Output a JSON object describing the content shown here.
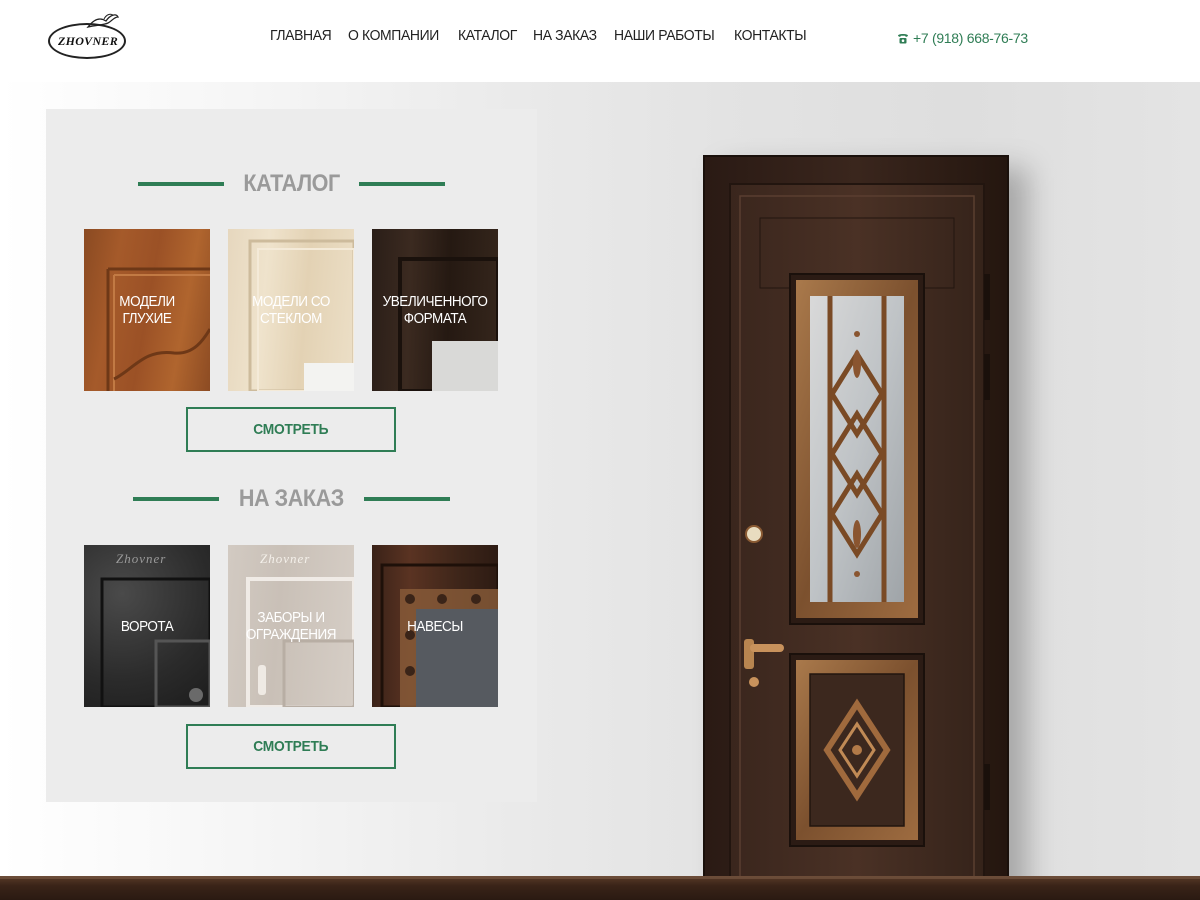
{
  "brand": {
    "logo_text": "ZHOVNER"
  },
  "nav": {
    "items": [
      {
        "label": "ГЛАВНАЯ"
      },
      {
        "label": "О КОМПАНИИ"
      },
      {
        "label": "КАТАЛОГ"
      },
      {
        "label": "НА ЗАКАЗ"
      },
      {
        "label": "НАШИ РАБОТЫ"
      },
      {
        "label": "КОНТАКТЫ"
      }
    ]
  },
  "contact": {
    "phone": "+7 (918) 668-76-73",
    "phone_icon": "phone-icon"
  },
  "catalog": {
    "title": "КАТАЛОГ",
    "tiles": [
      {
        "label": "МОДЕЛИ ГЛУХИЕ"
      },
      {
        "label": "МОДЕЛИ СО СТЕКЛОМ"
      },
      {
        "label": "УВЕЛИЧЕННОГО ФОРМАТА"
      }
    ],
    "button_label": "СМОТРЕТЬ"
  },
  "custom": {
    "title": "НА ЗАКАЗ",
    "tiles": [
      {
        "label": "ВОРОТА",
        "watermark": "Zhovner"
      },
      {
        "label": "ЗАБОРЫ И ОГРАЖДЕНИЯ",
        "watermark": "Zhovner"
      },
      {
        "label": "НАВЕСЫ"
      }
    ],
    "button_label": "СМОТРЕТЬ"
  },
  "colors": {
    "accent": "#2f7d55",
    "title_gray": "#9a9a9a",
    "panel_bg": "#ececec"
  }
}
